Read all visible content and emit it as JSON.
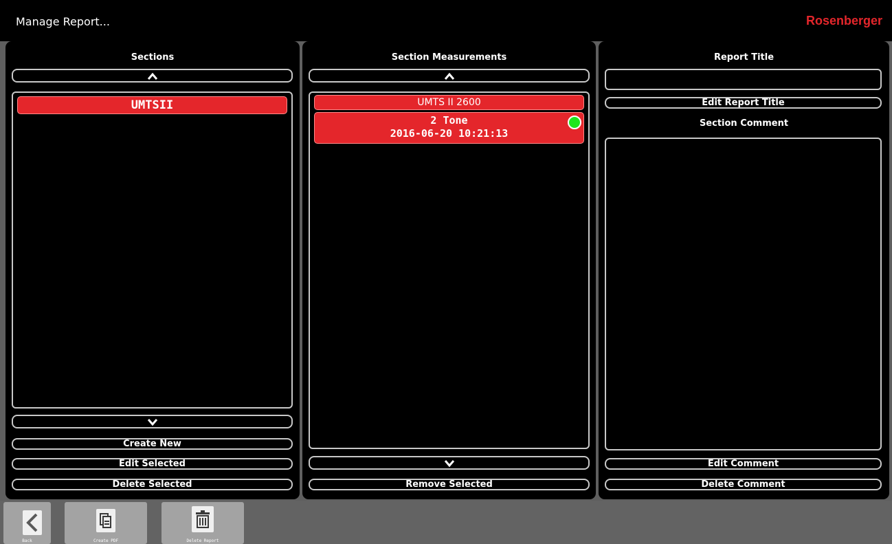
{
  "window": {
    "title": "Manage Report...",
    "brand": "Rosenberger"
  },
  "sections_panel": {
    "title": "Sections",
    "items": [
      {
        "label": "UMTSII",
        "selected": true
      }
    ],
    "create_label": "Create New",
    "edit_label": "Edit Selected",
    "delete_label": "Delete Selected"
  },
  "measurements_panel": {
    "title": "Section Measurements",
    "header_label": "UMTS II 2600",
    "items": [
      {
        "name": "2 Tone",
        "timestamp": "2016-06-20 10:21:13",
        "status": "pass",
        "selected": true
      }
    ],
    "remove_label": "Remove Selected"
  },
  "report_panel": {
    "title": "Report Title",
    "report_title_value": "",
    "edit_title_label": "Edit Report Title",
    "comment_heading": "Section Comment",
    "comment_value": "",
    "edit_comment_label": "Edit Comment",
    "delete_comment_label": "Delete Comment"
  },
  "toolbar": {
    "back_label": "Back",
    "create_pdf_label": "Create PDF",
    "delete_report_label": "Delete Report"
  },
  "colors": {
    "accent_red": "#e4262b",
    "status_green": "#1ee61e",
    "toolbar_gray": "#636363"
  },
  "icons": [
    "chevron-up-icon",
    "chevron-down-icon",
    "back-arrow-icon",
    "copy-document-icon",
    "trash-icon",
    "status-dot-icon"
  ]
}
